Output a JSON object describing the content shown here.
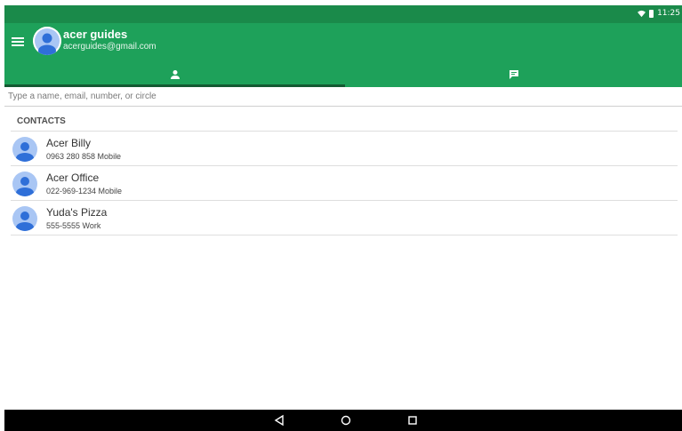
{
  "status_bar": {
    "time": "11:25",
    "icons": [
      "wifi-icon",
      "battery-icon"
    ]
  },
  "app_bar": {
    "account_name": "acer guides",
    "account_email": "acerguides@gmail.com",
    "tabs": [
      {
        "id": "people",
        "icon": "person-icon",
        "selected": true
      },
      {
        "id": "chat",
        "icon": "chat-icon",
        "selected": false
      }
    ]
  },
  "search": {
    "placeholder": "Type a name, email, number, or circle",
    "value": ""
  },
  "contacts": {
    "header": "CONTACTS",
    "items": [
      {
        "name": "Acer Billy",
        "detail": "0963 280 858 Mobile"
      },
      {
        "name": "Acer Office",
        "detail": "022-969-1234 Mobile"
      },
      {
        "name": "Yuda's Pizza",
        "detail": "555-5555 Work"
      }
    ]
  },
  "nav_bar": {
    "buttons": [
      "back-icon",
      "home-icon",
      "recents-icon"
    ]
  },
  "colors": {
    "status_bar": "#1a8a4a",
    "app_bar": "#1ea15a",
    "tab_indicator": "#145a32",
    "avatar": "#a9c6f4"
  }
}
